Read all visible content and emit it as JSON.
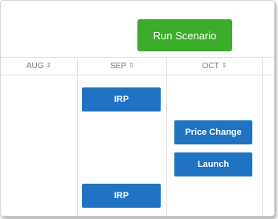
{
  "toolbar": {
    "run_button_label": "Run Scenario"
  },
  "columns": [
    {
      "label": "AUG",
      "sort_icon": "sort-icon"
    },
    {
      "label": "SEP",
      "sort_icon": "sort-icon"
    },
    {
      "label": "OCT",
      "sort_icon": "sort-icon"
    }
  ],
  "tasks": {
    "sep_top": "IRP",
    "sep_bottom": "IRP",
    "oct_price_change": "Price Change",
    "oct_launch": "Launch"
  },
  "colors": {
    "run_button": "#3dab2c",
    "task_block": "#1f73c2"
  }
}
